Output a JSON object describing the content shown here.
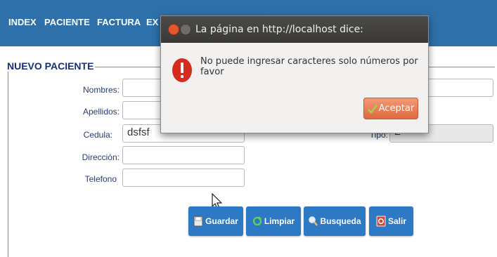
{
  "nav": {
    "items": [
      "INDEX",
      "PACIENTE",
      "FACTURA",
      "EX"
    ]
  },
  "form": {
    "legend": "NUEVO PACIENTE",
    "fields": {
      "nombres": {
        "label": "Nombres:",
        "value": ""
      },
      "apellidos": {
        "label": "Apellidos:",
        "value": ""
      },
      "cedula": {
        "label": "Cedula:",
        "value": "dsfsf"
      },
      "direccion": {
        "label": "Dirección:",
        "value": ""
      },
      "telefono": {
        "label": "Telefono",
        "value": ""
      },
      "tipo": {
        "label": "Tipo:",
        "value": "E"
      }
    },
    "buttons": {
      "guardar": "Guardar",
      "limpiar": "Limpiar",
      "busqueda": "Busqueda",
      "salir": "Salir"
    }
  },
  "dialog": {
    "title": "La página en http://localhost dice:",
    "message": "No puede ingresar caracteres solo números por favor",
    "accept": "Aceptar"
  },
  "colors": {
    "nav_bg": "#2e70a9",
    "button_bg": "#2e79c4",
    "dialog_accept": "#e06a3f",
    "error_icon": "#d62b1f"
  }
}
